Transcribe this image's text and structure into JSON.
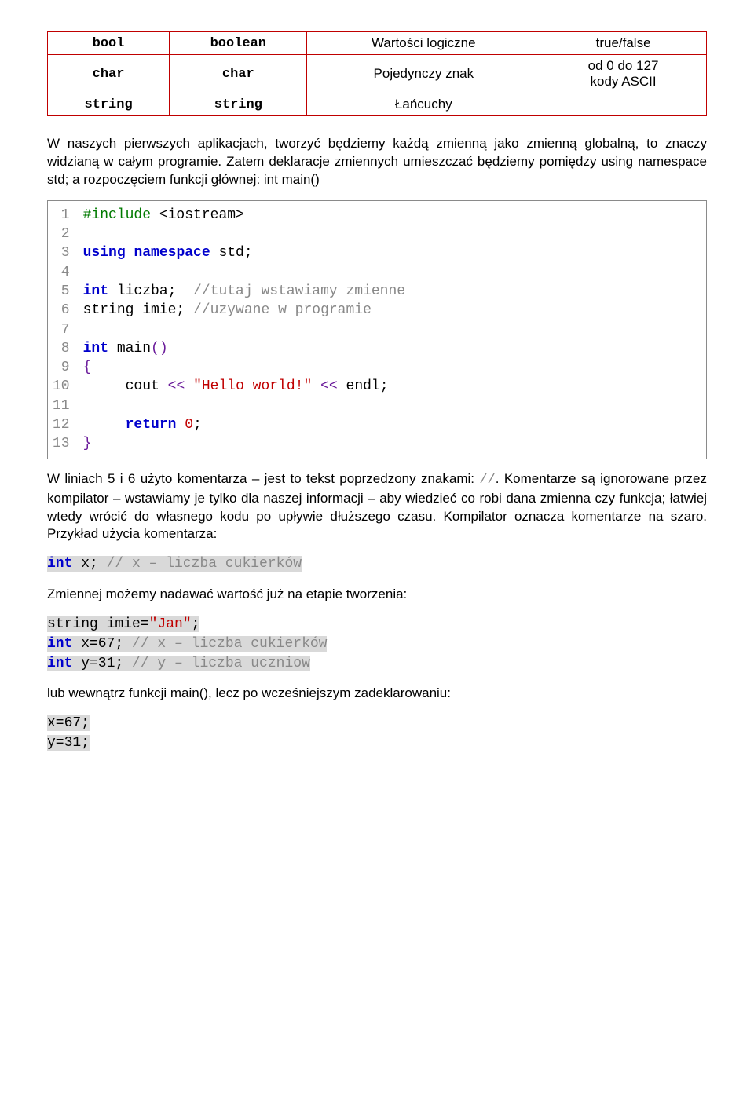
{
  "table": {
    "rows": [
      [
        "bool",
        "boolean",
        "Wartości logiczne",
        "true/false"
      ],
      [
        "char",
        "char",
        "Pojedynczy znak",
        "od 0 do 127\nkody ASCII"
      ],
      [
        "string",
        "string",
        "Łańcuchy",
        ""
      ]
    ]
  },
  "para1": "W naszych pierwszych aplikacjach, tworzyć będziemy każdą zmienną jako zmienną globalną, to znaczy widzianą w całym programie. Zatem deklaracje zmiennych umieszczać będziemy pomiędzy using namespace std; a rozpoczęciem funkcji głównej: int main()",
  "codebox": {
    "line_numbers": " 1\n 2\n 3\n 4\n 5\n 6\n 7\n 8\n 9\n10\n11\n12\n13",
    "lines": {
      "l1a": "#include",
      "l1b": " <iostream>",
      "l3a": "using",
      "l3b": " ",
      "l3c": "namespace",
      "l3d": " std;",
      "l5a": "int",
      "l5b": " liczba;  ",
      "l5c": "//tutaj wstawiamy zmienne",
      "l6a": "string imie; ",
      "l6b": "//uzywane w programie",
      "l8a": "int",
      "l8b": " main",
      "l8c": "()",
      "l9": "{",
      "l10a": "     cout ",
      "l10b": "<<",
      "l10c": " ",
      "l10d": "\"Hello world!\"",
      "l10e": " ",
      "l10f": "<<",
      "l10g": " endl;",
      "l12a": "     ",
      "l12b": "return",
      "l12c": " ",
      "l12d": "0",
      "l12e": ";",
      "l13": "}"
    }
  },
  "para2_a": "W liniach 5 i 6 użyto komentarza – jest to tekst poprzedzony znakami: ",
  "para2_b": "//",
  "para2_c": ". Komentarze są ignorowane przez kompilator – wstawiamy je tylko dla naszej informacji – aby wiedzieć co robi dana zmienna czy funkcja; łatwiej wtedy wrócić do własnego kodu po upływie dłuższego czasu. Kompilator oznacza komentarze na szaro. Przykład użycia komentarza:",
  "inline1": {
    "a": "int",
    "b": " x; ",
    "c": "// x – liczba cukierków"
  },
  "para3": "Zmiennej możemy nadawać wartość już na etapie tworzenia:",
  "inline2": {
    "l1a": "string imie=",
    "l1b": "\"Jan\"",
    "l1c": ";",
    "l2a": "int",
    "l2b": " x=67; ",
    "l2c": "// x – liczba cukierków",
    "l3a": "int",
    "l3b": " y=31; ",
    "l3c": "// y – liczba uczniow"
  },
  "para4": "lub wewnątrz funkcji main(), lecz po wcześniejszym zadeklarowaniu:",
  "inline3": {
    "l1": "x=67;",
    "l2": "y=31;"
  }
}
